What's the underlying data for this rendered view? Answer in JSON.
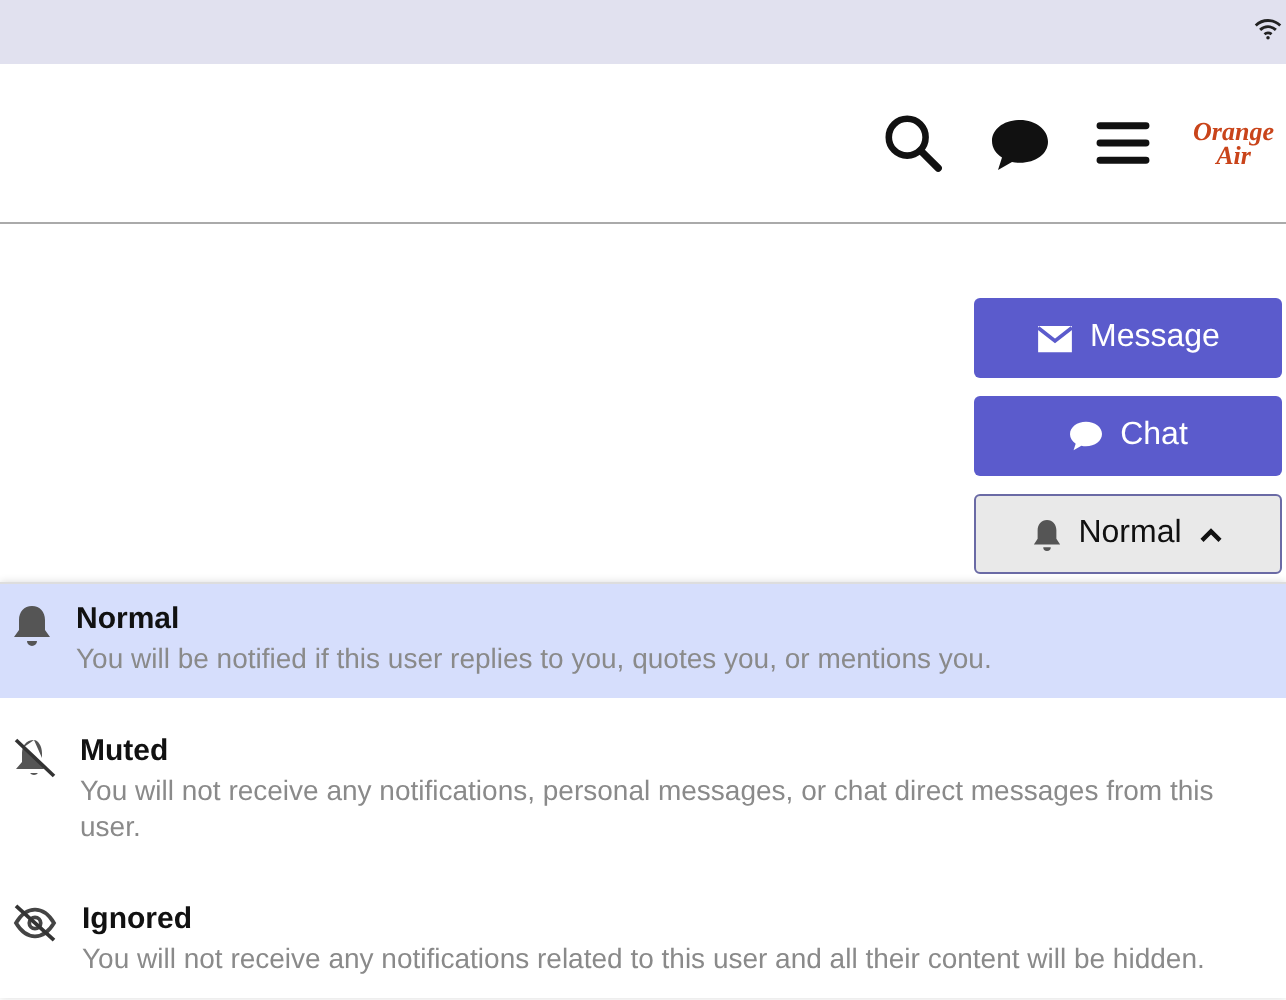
{
  "header": {
    "logo": {
      "line_1": "Orange",
      "line_2": "Air"
    }
  },
  "actions": [
    {
      "kind": "message",
      "label": "Message"
    },
    {
      "kind": "chat",
      "label": "Chat"
    },
    {
      "kind": "notification",
      "label": "Normal",
      "expanded": true
    }
  ],
  "menu": [
    {
      "kind": "normal",
      "title": "Normal",
      "description": "You will be notified if this user replies to you, quotes you, or mentions you.",
      "selected": true
    },
    {
      "kind": "muted",
      "title": "Muted",
      "description": "You will not receive any notifications, personal messages, or chat direct messages from this user.",
      "selected": false
    },
    {
      "kind": "ignored",
      "title": "Ignored",
      "description": "You will not receive any notifications related to this user and all their content will be hidden.",
      "selected": false
    }
  ]
}
